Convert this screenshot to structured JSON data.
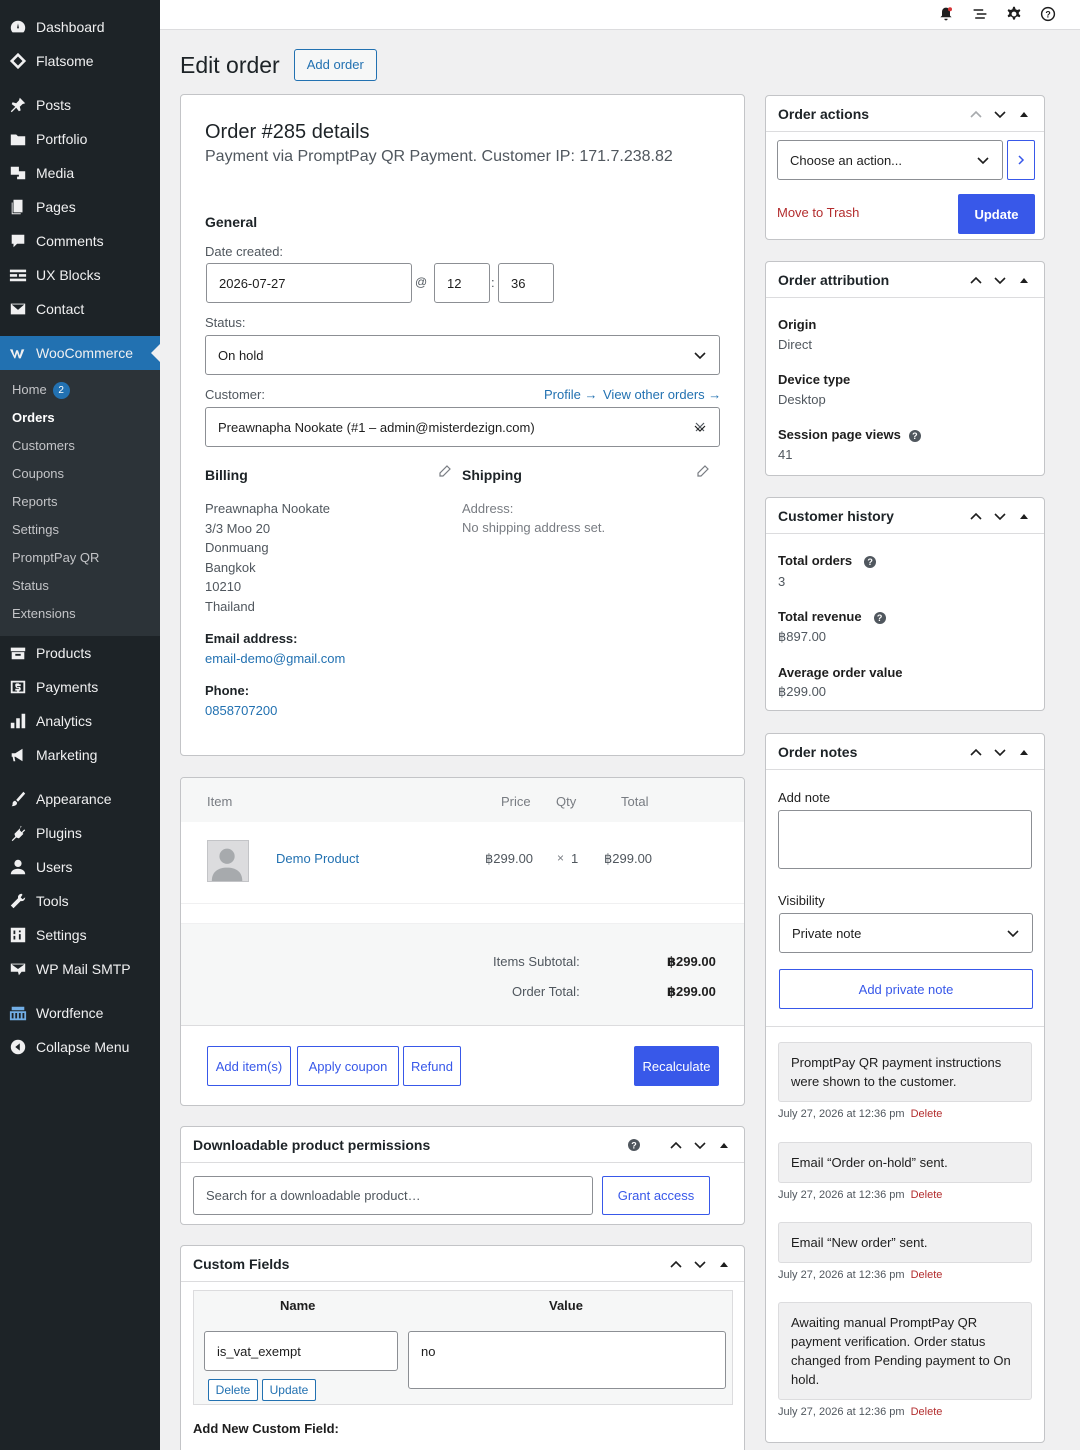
{
  "sidebar": {
    "items": [
      {
        "label": "Dashboard",
        "icon": "dashboard-icon"
      },
      {
        "label": "Flatsome",
        "icon": "flatsome-icon"
      },
      {
        "label": "Posts",
        "icon": "pin-icon"
      },
      {
        "label": "Portfolio",
        "icon": "portfolio-icon"
      },
      {
        "label": "Media",
        "icon": "media-icon"
      },
      {
        "label": "Pages",
        "icon": "pages-icon"
      },
      {
        "label": "Comments",
        "icon": "comment-icon"
      },
      {
        "label": "UX Blocks",
        "icon": "blocks-icon"
      },
      {
        "label": "Contact",
        "icon": "mail-icon"
      },
      {
        "label": "WooCommerce",
        "icon": "woo-icon"
      }
    ],
    "submenu": [
      "Home",
      "Orders",
      "Customers",
      "Coupons",
      "Reports",
      "Settings",
      "PromptPay QR",
      "Status",
      "Extensions"
    ],
    "home_badge": "2",
    "items2": [
      {
        "label": "Products",
        "icon": "products-icon"
      },
      {
        "label": "Payments",
        "icon": "payments-icon"
      },
      {
        "label": "Analytics",
        "icon": "analytics-icon"
      },
      {
        "label": "Marketing",
        "icon": "marketing-icon"
      },
      {
        "label": "Appearance",
        "icon": "brush-icon"
      },
      {
        "label": "Plugins",
        "icon": "plugin-icon"
      },
      {
        "label": "Users",
        "icon": "user-icon"
      },
      {
        "label": "Tools",
        "icon": "wrench-icon"
      },
      {
        "label": "Settings",
        "icon": "settings-icon"
      },
      {
        "label": "WP Mail SMTP",
        "icon": "smtp-icon"
      },
      {
        "label": "Wordfence",
        "icon": "wordfence-icon"
      },
      {
        "label": "Collapse Menu",
        "icon": "collapse-icon"
      }
    ]
  },
  "page": {
    "title": "Edit order",
    "add_button": "Add order"
  },
  "order": {
    "heading": "Order #285 details",
    "subheading": "Payment via PromptPay QR Payment. Customer IP: 171.7.238.82",
    "general_label": "General",
    "date_label": "Date created:",
    "date": "2026-07-27",
    "at": "@",
    "hour": "12",
    "colon": ":",
    "minute": "36",
    "status_label": "Status:",
    "status": "On hold",
    "customer_label": "Customer:",
    "profile_link": "Profile →",
    "other_orders_link": "View other orders →",
    "customer": "Preawnapha Nookate (#1 – admin@misterdezign.com)",
    "billing_label": "Billing",
    "billing_lines": [
      "Preawnapha Nookate",
      "3/3 Moo 20",
      "Donmuang",
      "Bangkok",
      "10210",
      "Thailand"
    ],
    "email_label": "Email address:",
    "email": "email-demo@gmail.com",
    "phone_label": "Phone:",
    "phone": "0858707200",
    "shipping_label": "Shipping",
    "address_label": "Address:",
    "no_shipping": "No shipping address set."
  },
  "items": {
    "headers": {
      "item": "Item",
      "price": "Price",
      "qty": "Qty",
      "total": "Total"
    },
    "product": {
      "name": "Demo Product",
      "price": "฿299.00",
      "qty_x": "×",
      "qty": "1",
      "total": "฿299.00"
    },
    "subtotal_label": "Items Subtotal:",
    "subtotal": "฿299.00",
    "total_label": "Order Total:",
    "total": "฿299.00",
    "buttons": {
      "add": "Add item(s)",
      "coupon": "Apply coupon",
      "refund": "Refund",
      "recalc": "Recalculate"
    }
  },
  "downloads": {
    "title": "Downloadable product permissions",
    "placeholder": "Search for a downloadable product…",
    "grant": "Grant access"
  },
  "custom_fields": {
    "title": "Custom Fields",
    "col_name": "Name",
    "col_value": "Value",
    "name": "is_vat_exempt",
    "value": "no",
    "delete": "Delete",
    "update": "Update",
    "add_new": "Add New Custom Field:"
  },
  "order_actions": {
    "title": "Order actions",
    "select": "Choose an action...",
    "trash": "Move to Trash",
    "update": "Update"
  },
  "attribution": {
    "title": "Order attribution",
    "origin_label": "Origin",
    "origin": "Direct",
    "device_label": "Device type",
    "device": "Desktop",
    "views_label": "Session page views",
    "views": "41"
  },
  "history": {
    "title": "Customer history",
    "total_orders_label": "Total orders",
    "total_orders": "3",
    "revenue_label": "Total revenue",
    "revenue": "฿897.00",
    "avg_label": "Average order value",
    "avg": "฿299.00"
  },
  "notes": {
    "title": "Order notes",
    "add_label": "Add note",
    "visibility_label": "Visibility",
    "visibility": "Private note",
    "add_button": "Add private note",
    "delete": "Delete",
    "list": [
      {
        "text": "PromptPay QR payment instructions were shown to the customer.",
        "meta": "July 27, 2026 at 12:36 pm"
      },
      {
        "text": "Email “Order on-hold” sent.",
        "meta": "July 27, 2026 at 12:36 pm"
      },
      {
        "text": "Email “New order” sent.",
        "meta": "July 27, 2026 at 12:36 pm"
      },
      {
        "text": "Awaiting manual PromptPay QR payment verification. Order status changed from Pending payment to On hold.",
        "meta": "July 27, 2026 at 12:36 pm"
      }
    ]
  },
  "colors": {
    "accent": "#3858e9",
    "sidebar": "#1d2327",
    "active": "#2271b1",
    "trash": "#b32d2e"
  }
}
